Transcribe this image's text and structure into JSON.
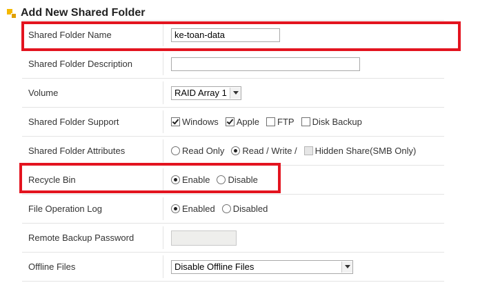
{
  "header": {
    "title": "Add New Shared Folder",
    "icon": "folder-section-icon"
  },
  "rows": {
    "name": {
      "label": "Shared Folder Name",
      "value": "ke-toan-data"
    },
    "description": {
      "label": "Shared Folder Description",
      "value": ""
    },
    "volume": {
      "label": "Volume",
      "selected": "RAID Array 1"
    },
    "support": {
      "label": "Shared Folder Support",
      "options": [
        {
          "label": "Windows",
          "checked": true
        },
        {
          "label": "Apple",
          "checked": true
        },
        {
          "label": "FTP",
          "checked": false
        },
        {
          "label": "Disk Backup",
          "checked": false
        }
      ]
    },
    "attributes": {
      "label": "Shared Folder Attributes",
      "read_only": "Read Only",
      "read_write": "Read / Write /",
      "hidden_share": "Hidden Share(SMB Only)"
    },
    "recycle": {
      "label": "Recycle Bin",
      "enable": "Enable",
      "disable": "Disable"
    },
    "file_log": {
      "label": "File Operation Log",
      "enabled": "Enabled",
      "disabled": "Disabled"
    },
    "remote_backup": {
      "label": "Remote Backup Password",
      "value": ""
    },
    "offline": {
      "label": "Offline Files",
      "selected": "Disable Offline Files"
    }
  },
  "colors": {
    "highlight": "#e3141f",
    "header_icon": "#f5b800"
  }
}
